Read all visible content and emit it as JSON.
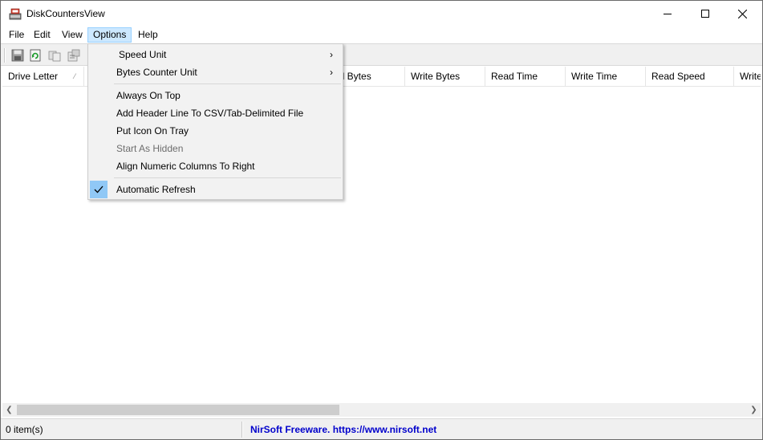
{
  "window": {
    "title": "DiskCountersView"
  },
  "menubar": {
    "items": [
      {
        "label": "File"
      },
      {
        "label": "Edit"
      },
      {
        "label": "View"
      },
      {
        "label": "Options"
      },
      {
        "label": "Help"
      }
    ],
    "active": "Options"
  },
  "toolbar": {
    "buttons": [
      {
        "icon": "save-icon"
      },
      {
        "icon": "refresh-icon"
      },
      {
        "icon": "copy-icon"
      },
      {
        "icon": "properties-icon"
      }
    ]
  },
  "columns": [
    {
      "label": "Drive Letter",
      "sorted": true
    },
    {
      "label": "ad Bytes"
    },
    {
      "label": "Write Bytes"
    },
    {
      "label": "Read Time"
    },
    {
      "label": "Write Time"
    },
    {
      "label": "Read Speed"
    },
    {
      "label": "Write"
    }
  ],
  "options_menu": {
    "group1": [
      {
        "label": "Speed Unit",
        "submenu": true
      },
      {
        "label": "Bytes Counter Unit",
        "submenu": true
      }
    ],
    "group2": [
      {
        "label": "Always On Top",
        "enabled": true
      },
      {
        "label": "Add Header Line To CSV/Tab-Delimited File",
        "enabled": true
      },
      {
        "label": "Put Icon On Tray",
        "enabled": true
      },
      {
        "label": "Start As Hidden",
        "enabled": false
      },
      {
        "label": "Align Numeric Columns To Right",
        "enabled": true
      }
    ],
    "group3": [
      {
        "label": "Automatic Refresh",
        "checked": true
      }
    ],
    "submenu_arrow": "›"
  },
  "statusbar": {
    "items_count": "0 item(s)",
    "credit": "NirSoft Freeware. https://www.nirsoft.net"
  },
  "colors": {
    "menu_active_bg": "#cce8ff",
    "check_bg": "#90c8f6",
    "status_link": "#0000cc"
  }
}
